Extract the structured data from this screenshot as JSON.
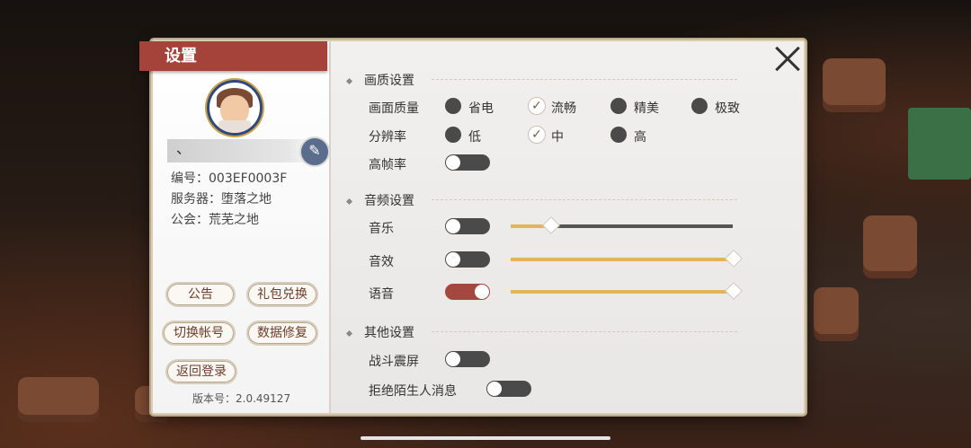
{
  "title": "设置",
  "profile": {
    "name": "、",
    "id_line": "编号：003EF0003F",
    "server_line": "服务器：堕落之地",
    "guild_line": "公会：荒芜之地"
  },
  "buttons": {
    "notice": "公告",
    "gift": "礼包兑换",
    "switch_account": "切换帐号",
    "repair": "数据修复",
    "back_login": "返回登录"
  },
  "version": "版本号：2.0.49127",
  "graphics": {
    "header": "画质设置",
    "quality_label": "画面质量",
    "quality_options": [
      "省电",
      "流畅",
      "精美",
      "极致"
    ],
    "quality_selected": "流畅",
    "resolution_label": "分辨率",
    "resolution_options": [
      "低",
      "中",
      "高"
    ],
    "resolution_selected": "中",
    "hfr_label": "高帧率",
    "hfr_on": false
  },
  "audio": {
    "header": "音频设置",
    "music_label": "音乐",
    "music_on": false,
    "music_level": 0.18,
    "sfx_label": "音效",
    "sfx_on": false,
    "sfx_level": 1.0,
    "voice_label": "语音",
    "voice_on": true,
    "voice_level": 1.0
  },
  "other": {
    "header": "其他设置",
    "shake_label": "战斗震屏",
    "shake_on": false,
    "reject_label": "拒绝陌生人消息",
    "reject_on": false
  },
  "colors": {
    "accent": "#a5433a",
    "slider_fill": "#e2b55a"
  }
}
